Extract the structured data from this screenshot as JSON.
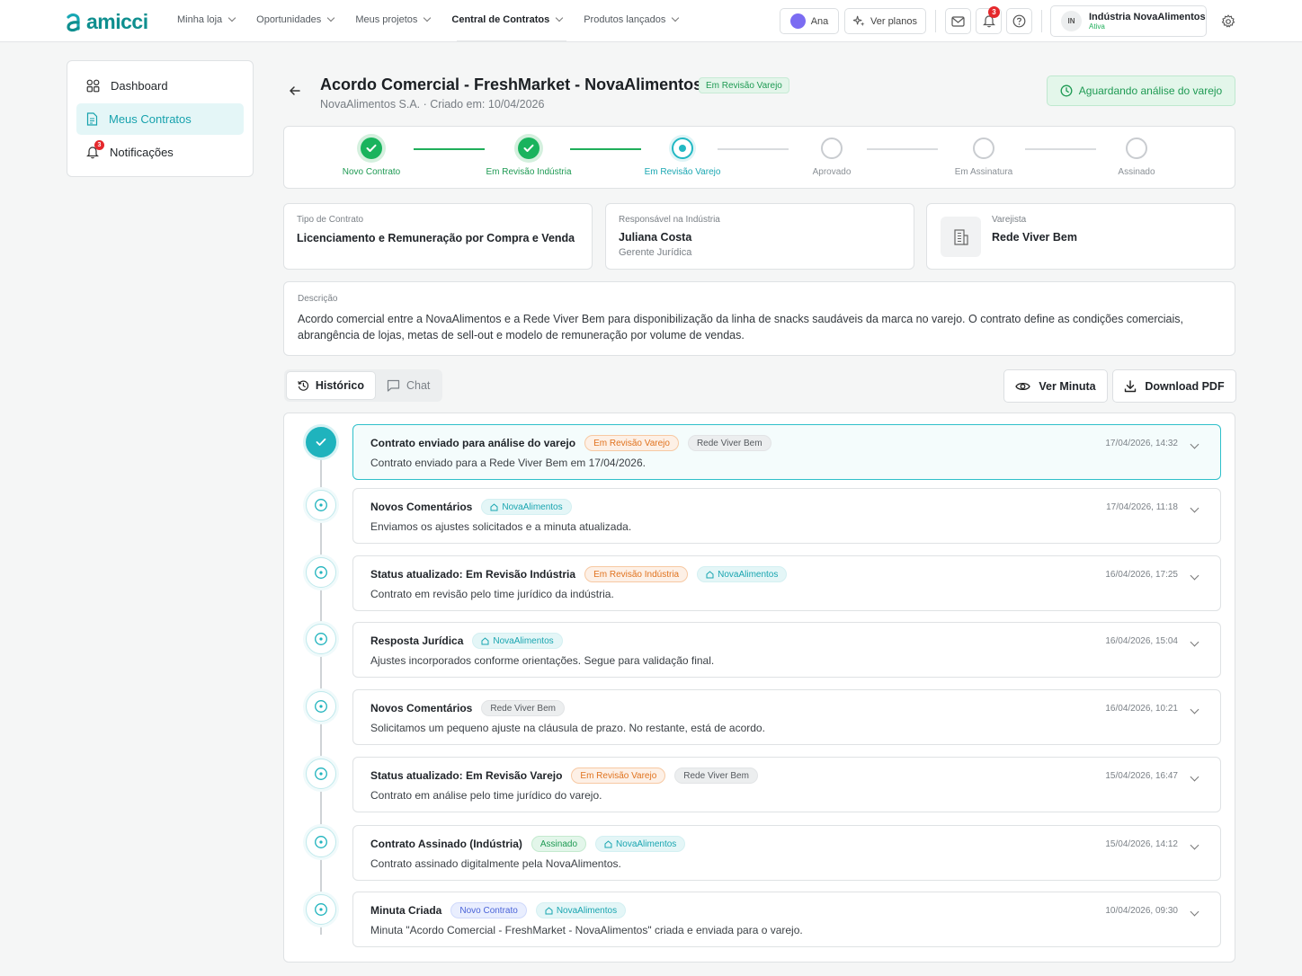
{
  "app": {
    "logo_text": "amicci",
    "brand_color": "#0f8f8f"
  },
  "nav": {
    "items": [
      {
        "label": "Minha loja"
      },
      {
        "label": "Oportunidades"
      },
      {
        "label": "Meus projetos"
      },
      {
        "label": "Central de Contratos"
      },
      {
        "label": "Produtos lançados"
      }
    ],
    "active": "Central de Contratos"
  },
  "topbar": {
    "user_label": "Ana",
    "plans_label": "Ver planos",
    "notifications_count": "3",
    "org_initials": "IN",
    "org_name": "Indústria NovaAlimentos",
    "org_status": "Ativa"
  },
  "sidebar": {
    "items": [
      {
        "label": "Dashboard",
        "icon": "grid-icon"
      },
      {
        "label": "Meus Contratos",
        "icon": "document-icon"
      },
      {
        "label": "Notificações",
        "icon": "bell-icon",
        "badge": "3"
      }
    ]
  },
  "header": {
    "title": "Acordo Comercial - FreshMarket - NovaAlimentos",
    "status_badge": "Em Revisão Varejo",
    "subtitle": "NovaAlimentos S.A. · Criado em: 10/04/2026",
    "await_label": "Aguardando análise do varejo"
  },
  "stepper": {
    "steps": [
      {
        "label": "Novo Contrato",
        "state": "done"
      },
      {
        "label": "Em Revisão Indústria",
        "state": "done"
      },
      {
        "label": "Em Revisão Varejo",
        "state": "current"
      },
      {
        "label": "Aprovado",
        "state": "todo"
      },
      {
        "label": "Em Assinatura",
        "state": "todo"
      },
      {
        "label": "Assinado",
        "state": "todo"
      }
    ]
  },
  "info": {
    "type_label": "Tipo de Contrato",
    "type_value": "Licenciamento e Remuneração por Compra e Venda",
    "resp_label": "Responsável na Indústria",
    "resp_name": "Juliana Costa",
    "resp_role": "Gerente Jurídica",
    "retailer_label": "Varejista",
    "retailer_name": "Rede Viver Bem"
  },
  "description": {
    "label": "Descrição",
    "text": "Acordo comercial entre a NovaAlimentos e a Rede Viver Bem para disponibilização da linha de snacks saudáveis da marca no varejo. O contrato define as condições comerciais, abrangência de lojas, metas de sell-out e modelo de remuneração por volume de vendas."
  },
  "tabs": {
    "history": "Histórico",
    "chat": "Chat"
  },
  "actions": {
    "view_draft": "Ver Minuta",
    "download": "Download PDF"
  },
  "timeline": [
    {
      "title": "Contrato enviado para análise do varejo",
      "tags": [
        {
          "text": "Em Revisão Varejo",
          "kind": "orange"
        },
        {
          "text": "Rede Viver Bem",
          "kind": "gray"
        }
      ],
      "body": "Contrato enviado para a Rede Viver Bem em 17/04/2026.",
      "time": "17/04/2026, 14:32"
    },
    {
      "title": "Novos Comentários",
      "tags": [
        {
          "text": "NovaAlimentos",
          "kind": "teal"
        }
      ],
      "body": "Enviamos os ajustes solicitados e a minuta atualizada.",
      "time": "17/04/2026, 11:18"
    },
    {
      "title": "Status atualizado: Em Revisão Indústria",
      "tags": [
        {
          "text": "Em Revisão Indústria",
          "kind": "orange"
        },
        {
          "text": "NovaAlimentos",
          "kind": "teal"
        }
      ],
      "body": "Contrato em revisão pelo time jurídico da indústria.",
      "time": "16/04/2026, 17:25"
    },
    {
      "title": "Resposta Jurídica",
      "tags": [
        {
          "text": "NovaAlimentos",
          "kind": "teal"
        }
      ],
      "body": "Ajustes incorporados conforme orientações. Segue para validação final.",
      "time": "16/04/2026, 15:04"
    },
    {
      "title": "Novos Comentários",
      "tags": [
        {
          "text": "Rede Viver Bem",
          "kind": "gray"
        }
      ],
      "body": "Solicitamos um pequeno ajuste na cláusula de prazo. No restante, está de acordo.",
      "time": "16/04/2026, 10:21"
    },
    {
      "title": "Status atualizado: Em Revisão Varejo",
      "tags": [
        {
          "text": "Em Revisão Varejo",
          "kind": "orange"
        },
        {
          "text": "Rede Viver Bem",
          "kind": "gray"
        }
      ],
      "body": "Contrato em análise pelo time jurídico do varejo.",
      "time": "15/04/2026, 16:47"
    },
    {
      "title": "Contrato Assinado (Indústria)",
      "tags": [
        {
          "text": "Assinado",
          "kind": "green"
        },
        {
          "text": "NovaAlimentos",
          "kind": "teal"
        }
      ],
      "body": "Contrato assinado digitalmente pela NovaAlimentos.",
      "time": "15/04/2026, 14:12"
    },
    {
      "title": "Minuta Criada",
      "tags": [
        {
          "text": "Novo Contrato",
          "kind": "blue"
        },
        {
          "text": "NovaAlimentos",
          "kind": "teal"
        }
      ],
      "body": "Minuta \"Acordo Comercial - FreshMarket - NovaAlimentos\" criada e enviada para o varejo.",
      "time": "10/04/2026, 09:30"
    }
  ]
}
